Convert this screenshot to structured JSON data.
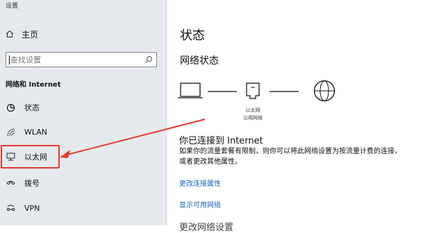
{
  "window": {
    "title": "设置"
  },
  "sidebar": {
    "home_label": "主页",
    "search": {
      "placeholder": "查找设置"
    },
    "section_title": "网络和 Internet",
    "items": [
      {
        "label": "状态",
        "icon": "globe-icon"
      },
      {
        "label": "WLAN",
        "icon": "wifi-icon"
      },
      {
        "label": "以太网",
        "icon": "ethernet-icon",
        "selected": true
      },
      {
        "label": "拨号",
        "icon": "dialup-icon"
      },
      {
        "label": "VPN",
        "icon": "vpn-icon"
      }
    ]
  },
  "main": {
    "title": "状态",
    "network_status_title": "网络状态",
    "diagram": {
      "adapter_name": "以太网",
      "network_type": "公用网络"
    },
    "connected_title": "你已连接到 Internet",
    "connected_desc": "如果你的流量套餐有限制，则你可以将此网络设置为按流量计费的连接，或者更改其他属性。",
    "links": {
      "change_properties": "更改连接属性",
      "show_networks": "显示可用网络"
    },
    "next_section": "更改网络设置"
  },
  "annotation": {
    "color": "#e23a2f"
  }
}
